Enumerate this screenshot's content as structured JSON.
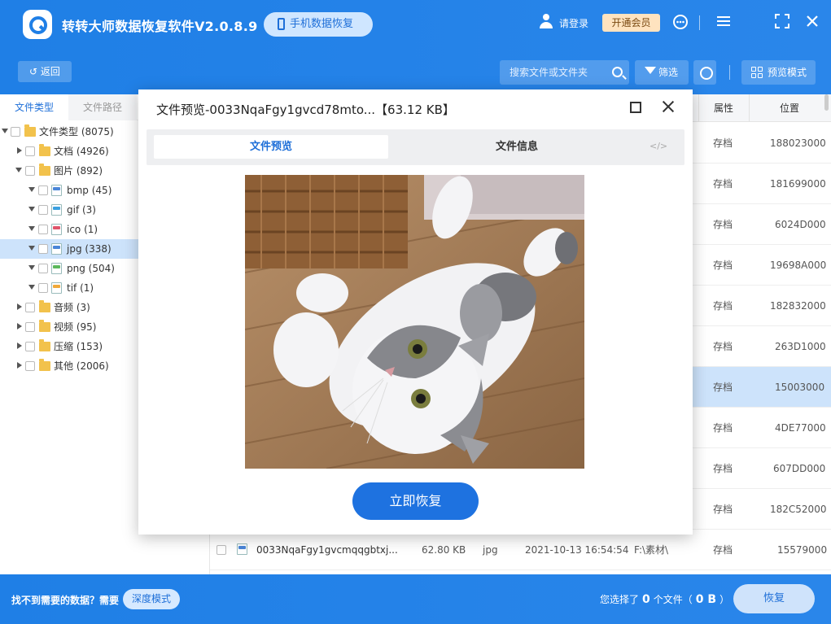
{
  "app": {
    "title": "转转大师数据恢复软件V2.0.8.9",
    "phone_recovery": "手机数据恢复",
    "login": "请登录",
    "vip": "开通会员"
  },
  "toolbar": {
    "back": "返回",
    "search_placeholder": "搜索文件或文件夹",
    "filter": "筛选",
    "preview_mode": "预览模式"
  },
  "sidebar": {
    "tabs": [
      "文件类型",
      "文件路径"
    ],
    "tree": [
      {
        "label": "文件类型 (8075)"
      },
      {
        "label": "文档 (4926)"
      },
      {
        "label": "图片 (892)"
      },
      {
        "label": "bmp (45)"
      },
      {
        "label": "gif (3)"
      },
      {
        "label": "ico (1)"
      },
      {
        "label": "jpg (338)"
      },
      {
        "label": "png (504)"
      },
      {
        "label": "tif (1)"
      },
      {
        "label": "音频 (3)"
      },
      {
        "label": "视频 (95)"
      },
      {
        "label": "压缩 (153)"
      },
      {
        "label": "其他 (2006)"
      }
    ]
  },
  "list": {
    "headers": {
      "attr": "属性",
      "pos": "位置"
    },
    "rows": [
      {
        "attr": "存档",
        "pos": "188023000"
      },
      {
        "attr": "存档",
        "pos": "181699000"
      },
      {
        "attr": "存档",
        "pos": "6024D000"
      },
      {
        "attr": "存档",
        "pos": "19698A000"
      },
      {
        "attr": "存档",
        "pos": "182832000"
      },
      {
        "attr": "存档",
        "pos": "263D1000"
      },
      {
        "attr": "存档",
        "pos": "15003000"
      },
      {
        "attr": "存档",
        "pos": "4DE77000"
      },
      {
        "attr": "存档",
        "pos": "607DD000"
      },
      {
        "attr": "存档",
        "pos": "182C52000"
      },
      {
        "name": "0033NqaFgy1gvcmqqgbtxj...",
        "size": "62.80 KB",
        "type": "jpg",
        "time": "2021-10-13 16:54:54",
        "path": "F:\\素材\\",
        "attr": "存档",
        "pos": "15579000"
      }
    ]
  },
  "bottom": {
    "not_found": "找不到需要的数据？需要",
    "deep_mode": "深度模式",
    "selected_prefix": "您选择了",
    "selected_count": "0",
    "selected_mid": "个文件（",
    "selected_size": "0 B",
    "selected_suffix": "）",
    "recover": "恢复"
  },
  "modal": {
    "title": "文件预览-0033NqaFgy1gvcd78mto...【63.12 KB】",
    "tab_preview": "文件预览",
    "tab_info": "文件信息",
    "code": "</>",
    "recover_now": "立即恢复"
  },
  "colors": {
    "brand": "#1f7fe6",
    "selected_row": "#cde3fb",
    "vip_bg": "#ffe3bf"
  }
}
